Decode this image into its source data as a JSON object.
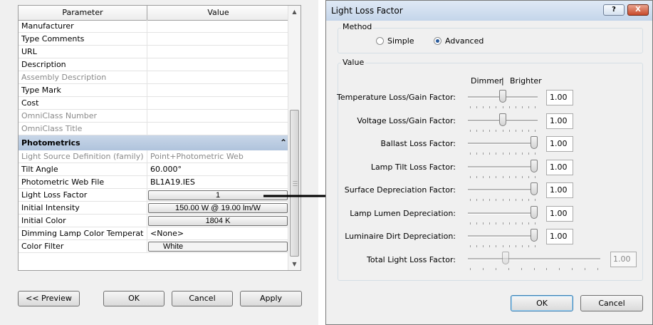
{
  "properties": {
    "header": {
      "param": "Parameter",
      "value": "Value"
    },
    "rows": [
      {
        "label": "Manufacturer",
        "value": "",
        "type": "text"
      },
      {
        "label": "Type Comments",
        "value": "",
        "type": "text"
      },
      {
        "label": "URL",
        "value": "",
        "type": "text"
      },
      {
        "label": "Description",
        "value": "",
        "type": "text"
      },
      {
        "label": "Assembly Description",
        "value": "",
        "type": "grey"
      },
      {
        "label": "Type Mark",
        "value": "",
        "type": "text"
      },
      {
        "label": "Cost",
        "value": "",
        "type": "text"
      },
      {
        "label": "OmniClass Number",
        "value": "",
        "type": "grey"
      },
      {
        "label": "OmniClass Title",
        "value": "",
        "type": "grey"
      },
      {
        "label": "Photometrics",
        "type": "group"
      },
      {
        "label": "Light Source Definition (family)",
        "value": "Point+Photometric Web",
        "type": "grey"
      },
      {
        "label": "Tilt Angle",
        "value": "60.000°",
        "type": "text"
      },
      {
        "label": "Photometric Web File",
        "value": "BL1A19.IES",
        "type": "text"
      },
      {
        "label": "Light Loss Factor",
        "value": "1",
        "type": "button"
      },
      {
        "label": "Initial Intensity",
        "value": "150.00 W @ 19.00 lm/W",
        "type": "button"
      },
      {
        "label": "Initial Color",
        "value": "1804 K",
        "type": "button"
      },
      {
        "label": "Dimming Lamp Color Temperat",
        "value": "<None>",
        "type": "text"
      },
      {
        "label": "Color Filter",
        "value": "White",
        "type": "flat"
      }
    ]
  },
  "buttons": {
    "preview": "<< Preview",
    "ok": "OK",
    "cancel": "Cancel",
    "apply": "Apply"
  },
  "dialog": {
    "title": "Light Loss Factor",
    "help": "?",
    "close": "X",
    "method": {
      "label": "Method",
      "options": [
        "Simple",
        "Advanced"
      ],
      "selected": "Advanced"
    },
    "value_group": {
      "label": "Value",
      "dimmer": "Dimmer",
      "separator": "|",
      "brighter": "Brighter"
    },
    "factors": [
      {
        "label": "Temperature Loss/Gain Factor:",
        "value": "1.00",
        "level": 0.5
      },
      {
        "label": "Voltage Loss/Gain Factor:",
        "value": "1.00",
        "level": 0.5
      },
      {
        "label": "Ballast Loss Factor:",
        "value": "1.00",
        "level": 1.0
      },
      {
        "label": "Lamp Tilt Loss Factor:",
        "value": "1.00",
        "level": 1.0
      },
      {
        "label": "Surface Depreciation Factor:",
        "value": "1.00",
        "level": 1.0
      },
      {
        "label": "Lamp Lumen  Depreciation:",
        "value": "1.00",
        "level": 1.0
      },
      {
        "label": "Luminaire Dirt  Depreciation:",
        "value": "1.00",
        "level": 1.0
      }
    ],
    "total": {
      "label": "Total Light Loss Factor:",
      "value": "1.00",
      "level": 0.27
    },
    "ok": "OK",
    "cancel": "Cancel"
  },
  "colors": {
    "accent": "#2a5a9a",
    "group_header": "#b9cbe0",
    "arrow": "#000000"
  }
}
